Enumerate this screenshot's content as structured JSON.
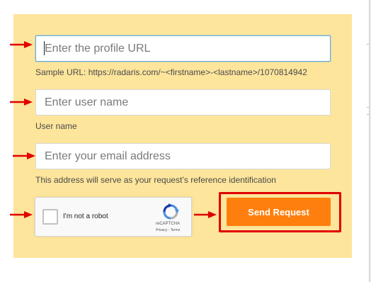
{
  "form": {
    "profile_url": {
      "placeholder": "Enter the profile URL",
      "value": ""
    },
    "profile_url_help": "Sample URL: https://radaris.com/~<firstname>-<lastname>/1070814942",
    "user_name": {
      "placeholder": "Enter user name",
      "value": ""
    },
    "user_name_help": "User name",
    "email": {
      "placeholder": "Enter your email address",
      "value": ""
    },
    "email_help": "This address will serve as your request’s reference identification",
    "submit_label": "Send Request"
  },
  "recaptcha": {
    "checkbox_label": "I'm not a robot",
    "checked": false,
    "brand": "reCAPTCHA",
    "links": "Privacy - Terms"
  },
  "annotations": {
    "arrow_color": "#e00000",
    "highlight_color": "#e00000"
  },
  "colors": {
    "panel_bg": "#fde59b",
    "button_bg": "#ff7f0e",
    "button_text": "#ffffff"
  }
}
